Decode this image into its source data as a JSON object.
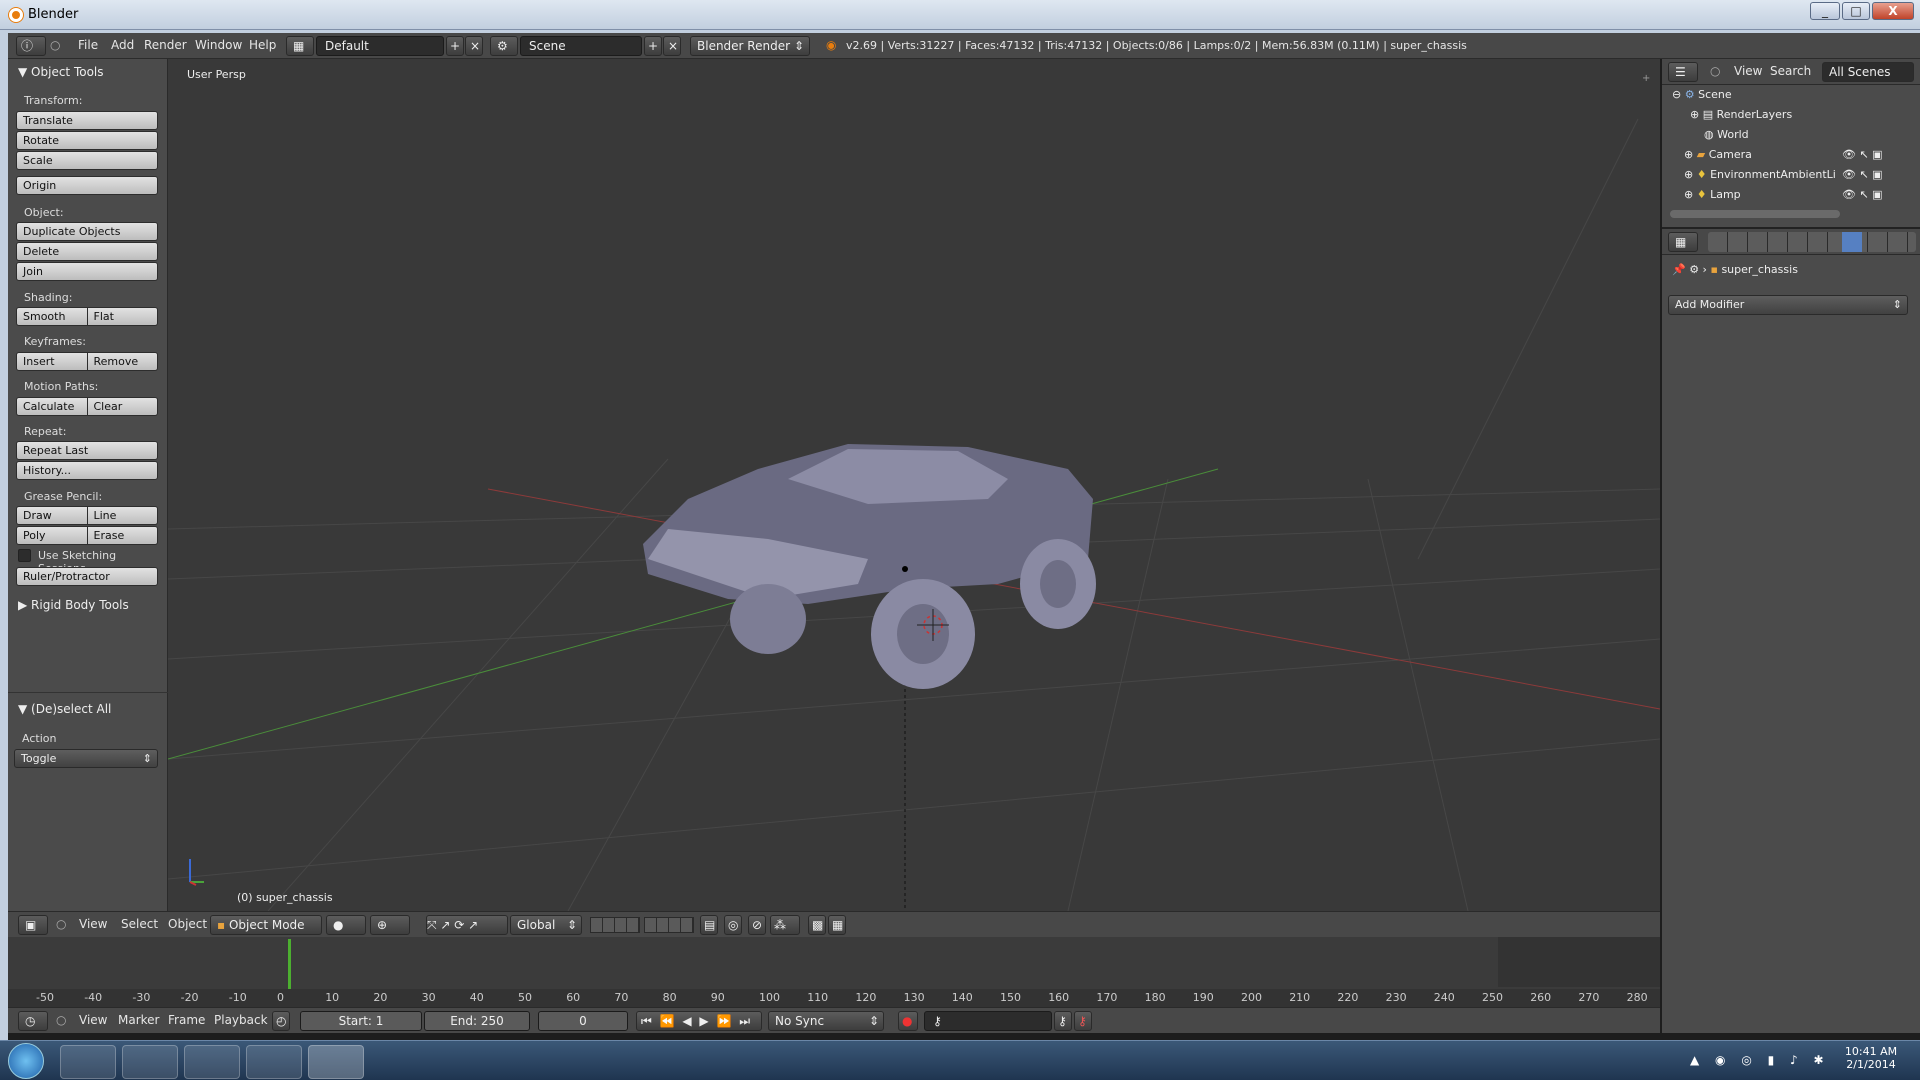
{
  "window": {
    "title": "Blender",
    "min": "_",
    "max": "□",
    "close": "X"
  },
  "info_header": {
    "menus": [
      "File",
      "Add",
      "Render",
      "Window",
      "Help"
    ],
    "layout": "Default",
    "scene": "Scene",
    "engine": "Blender Render",
    "stats": "v2.69 | Verts:31227 | Faces:47132 | Tris:47132 | Objects:0/86 | Lamps:0/2 | Mem:56.83M (0.11M) | super_chassis"
  },
  "tool_shelf": {
    "title": "Object Tools",
    "transform_label": "Transform:",
    "translate": "Translate",
    "rotate": "Rotate",
    "scale": "Scale",
    "origin": "Origin",
    "object_label": "Object:",
    "duplicate": "Duplicate Objects",
    "delete": "Delete",
    "join": "Join",
    "shading_label": "Shading:",
    "smooth": "Smooth",
    "flat": "Flat",
    "keyframes_label": "Keyframes:",
    "insert": "Insert",
    "remove": "Remove",
    "motion_label": "Motion Paths:",
    "calculate": "Calculate",
    "clear": "Clear",
    "repeat_label": "Repeat:",
    "repeat_last": "Repeat Last",
    "history": "History...",
    "grease_label": "Grease Pencil:",
    "draw": "Draw",
    "line": "Line",
    "poly": "Poly",
    "erase": "Erase",
    "sketching": "Use Sketching Sessions",
    "ruler": "Ruler/Protractor",
    "rigid": "Rigid Body Tools",
    "deselect_title": "(De)select All",
    "action_label": "Action",
    "action_value": "Toggle"
  },
  "viewport": {
    "persp": "User Persp",
    "object": "(0) super_chassis"
  },
  "view3d_header": {
    "menus": [
      "View",
      "Select",
      "Object"
    ],
    "mode": "Object Mode",
    "orientation": "Global"
  },
  "timeline": {
    "ticks": [
      "-50",
      "-40",
      "-30",
      "-20",
      "-10",
      "0",
      "10",
      "20",
      "30",
      "40",
      "50",
      "60",
      "70",
      "80",
      "90",
      "100",
      "110",
      "120",
      "130",
      "140",
      "150",
      "160",
      "170",
      "180",
      "190",
      "200",
      "210",
      "220",
      "230",
      "240",
      "250",
      "260",
      "270",
      "280"
    ],
    "menus": [
      "View",
      "Marker",
      "Frame",
      "Playback"
    ],
    "start": "Start: 1",
    "end": "End: 250",
    "current": "0",
    "sync": "No Sync"
  },
  "outliner": {
    "menus": [
      "View",
      "Search"
    ],
    "filter": "All Scenes",
    "items": [
      "Scene",
      "RenderLayers",
      "World",
      "Camera",
      "EnvironmentAmbientLi",
      "Lamp"
    ]
  },
  "properties": {
    "object": "super_chassis",
    "add_modifier": "Add Modifier"
  },
  "taskbar": {
    "time": "10:41 AM",
    "date": "2/1/2014"
  },
  "colors": {
    "accent": "#5680c2",
    "viewport": "#393939",
    "panel": "#4b4b4b"
  }
}
